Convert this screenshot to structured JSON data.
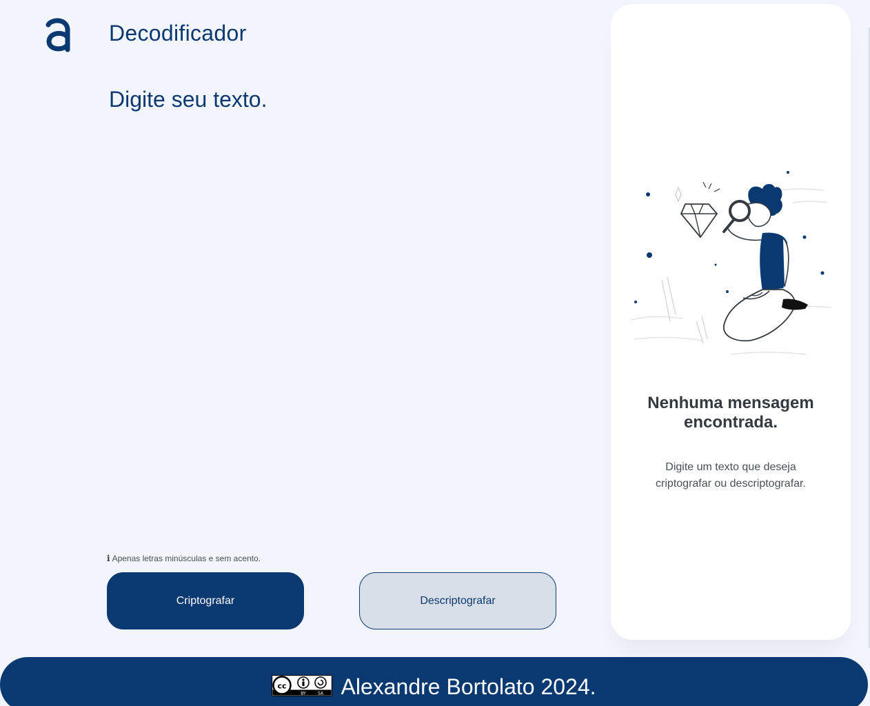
{
  "header": {
    "logo_icon": "alura-a-logo-icon",
    "title": "Decodificador"
  },
  "input": {
    "placeholder": "Digite seu texto.",
    "value": ""
  },
  "hint": {
    "icon": "info-icon",
    "text": "Apenas letras minúsculas e sem acento."
  },
  "buttons": {
    "encrypt_label": "Criptografar",
    "decrypt_label": "Descriptografar"
  },
  "output_panel": {
    "illustration": "person-magnifying-glass-diamond-illustration",
    "title": "Nenhuma mensagem encontrada.",
    "subtitle": "Digite um texto que deseja criptografar ou descriptografar."
  },
  "footer": {
    "license_badge": "cc-by-sa-icon",
    "text": "Alexandre Bortolato 2024."
  },
  "colors": {
    "primary": "#0a3871",
    "background": "#f3f5fc",
    "panel": "#ffffff",
    "secondary_button": "#d8dfe8"
  }
}
